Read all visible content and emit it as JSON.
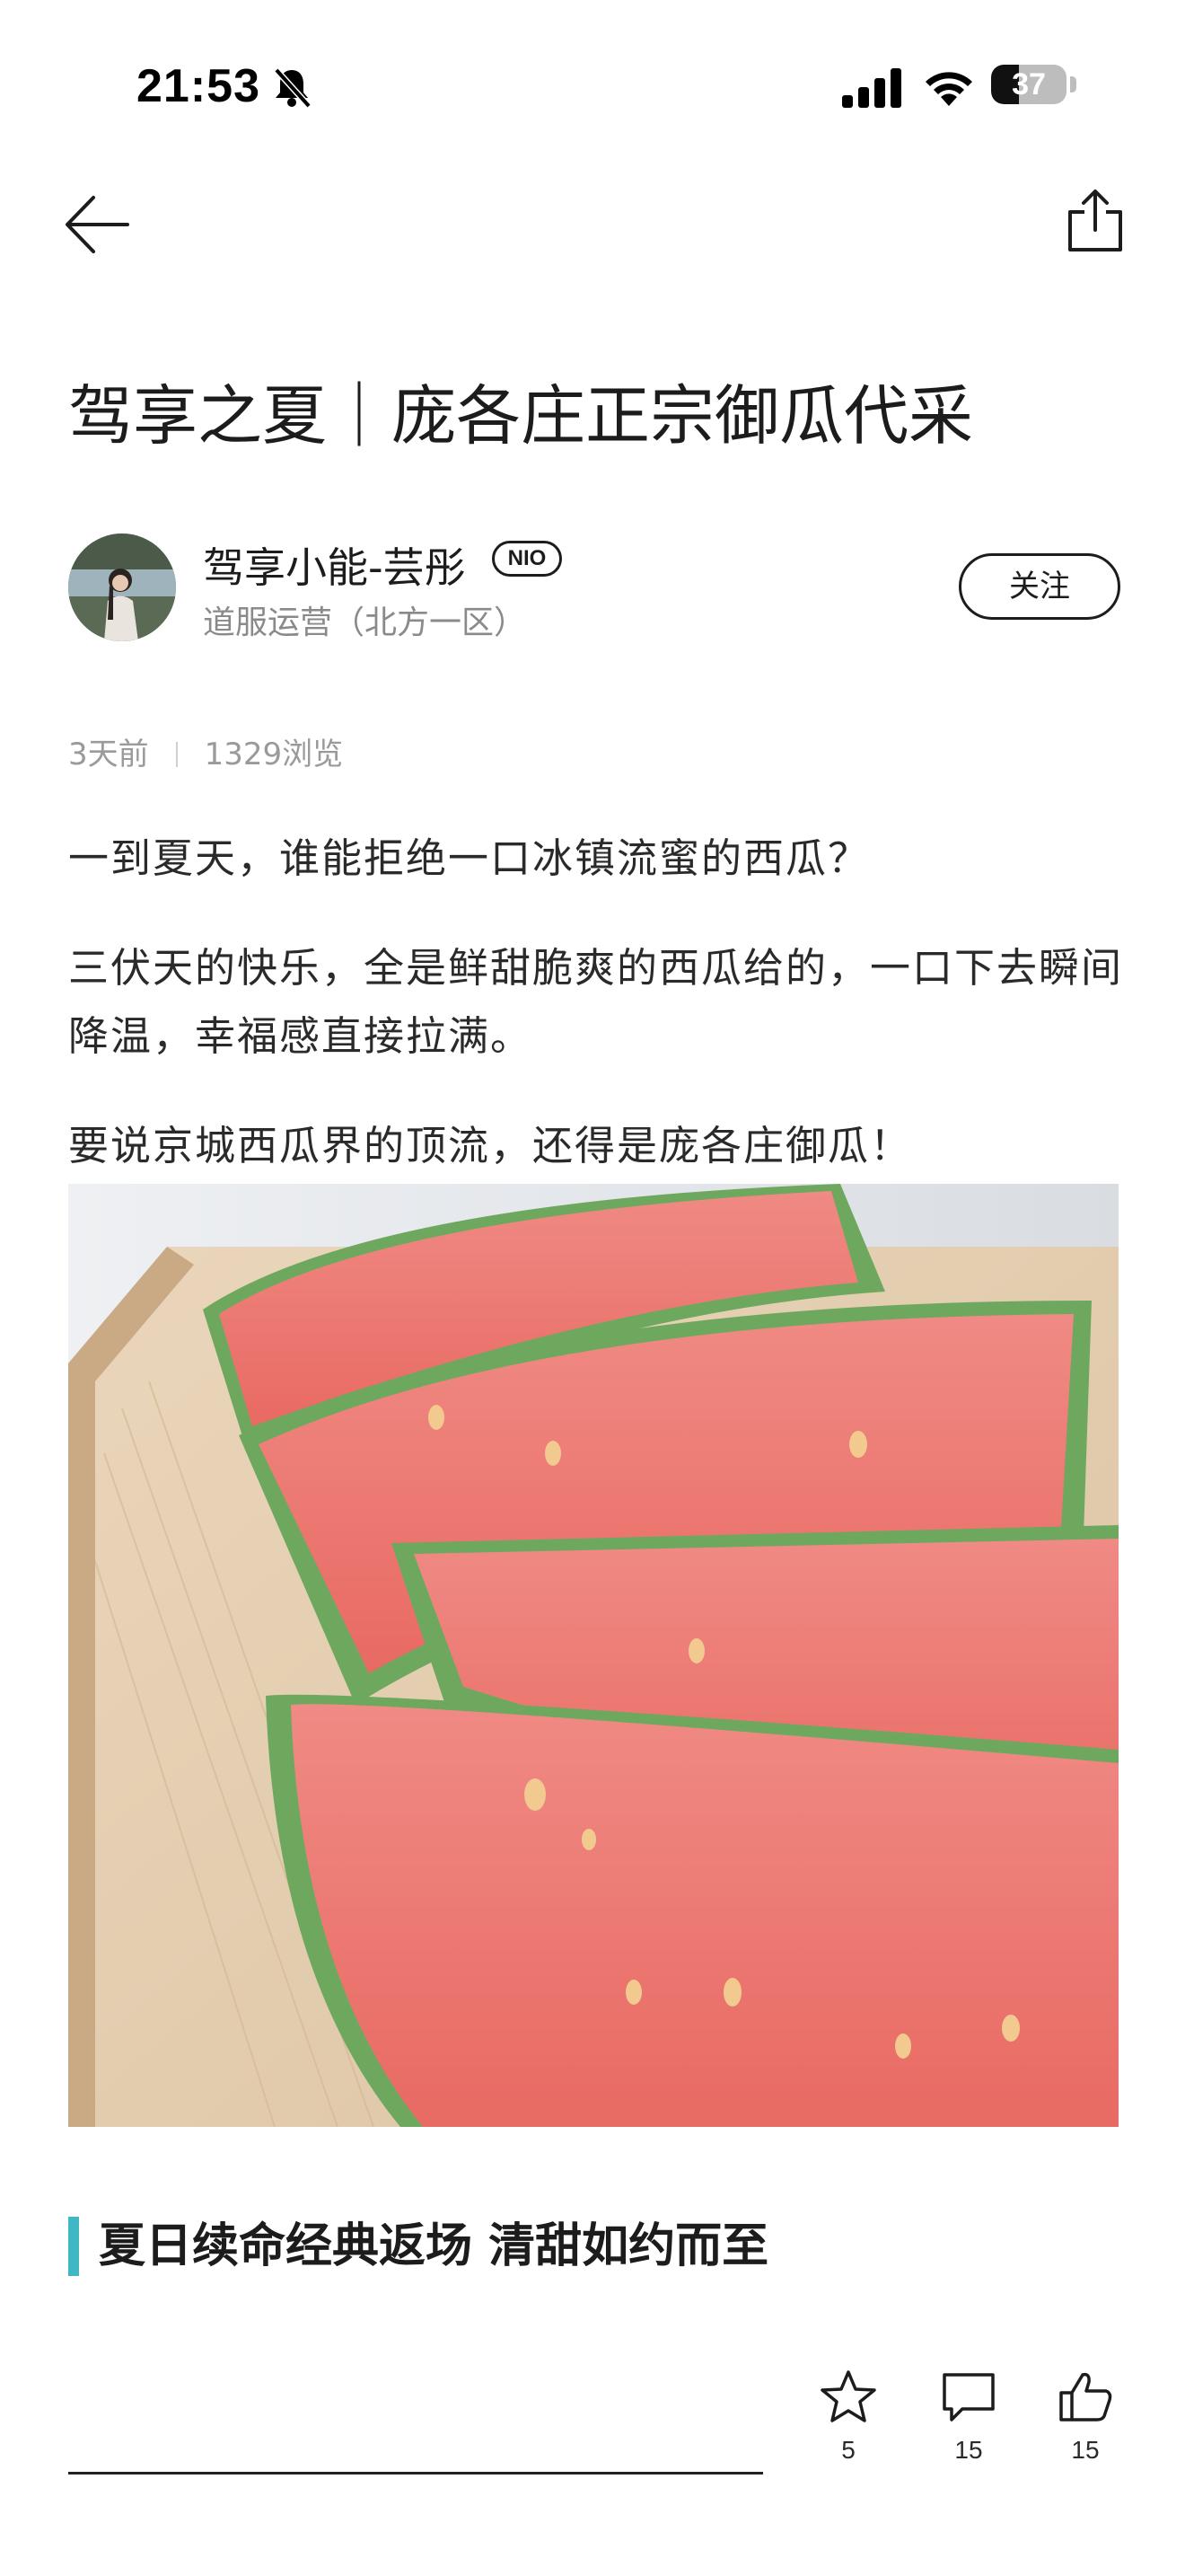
{
  "status_bar": {
    "time": "21:53",
    "battery": "37",
    "battery_level_percent": 37,
    "icons": [
      "bell-muted-icon",
      "cellular-signal-icon",
      "wifi-icon",
      "battery-icon"
    ]
  },
  "nav": {
    "icons": [
      "back-arrow-icon",
      "share-icon"
    ]
  },
  "article": {
    "title": "驾享之夏｜庞各庄正宗御瓜代采",
    "author": {
      "name": "驾享小能-芸彤",
      "badge": "NIO",
      "role": "道服运营（北方一区）",
      "follow_label": "关注"
    },
    "meta": {
      "time_ago": "3天前",
      "views": "1329浏览"
    },
    "paragraphs": [
      "一到夏天，谁能拒绝一口冰镇流蜜的西瓜？",
      "三伏天的快乐，全是鲜甜脆爽的西瓜给的，一口下去瞬间降温，幸福感直接拉满。",
      "要说京城西瓜界的顶流，还得是庞各庄御瓜！"
    ],
    "image": "watermelon-slices-photo",
    "subheading": "夏日续命经典返场 清甜如约而至"
  },
  "bottom_bar": {
    "comment_placeholder": "",
    "actions": [
      {
        "icon": "star-icon",
        "count": "5"
      },
      {
        "icon": "comment-icon",
        "count": "15"
      },
      {
        "icon": "thumbs-up-icon",
        "count": "15"
      }
    ]
  },
  "colors": {
    "accent": "#3fb8c4",
    "text": "#1c1c1c",
    "muted": "#9a9a9a"
  }
}
